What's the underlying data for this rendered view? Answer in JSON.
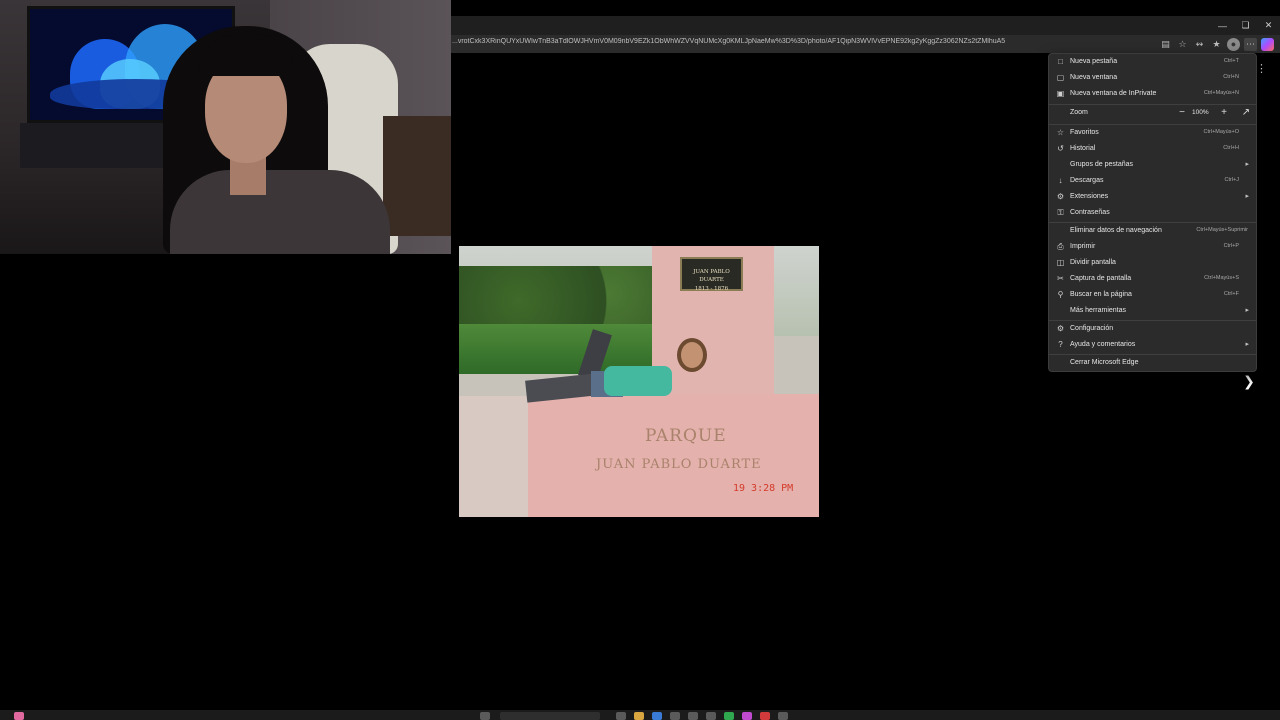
{
  "browser": {
    "url": "...vrotCxk3XRinQUYxUWIwTnB3aTdlOWJHVmV0M09nbV9EZk1ObWhWZVVqNUMcXg0KMLJpNaeMw%3D%3D/photo/AF1QipN3WVlVvEPNE92kg2yKggZz3062NZs2tZMlhuA5",
    "window_controls": [
      "minimize",
      "restore",
      "close"
    ],
    "toolbar_icons": [
      "reading-mode-icon",
      "favorite-star-icon",
      "extensions-icon",
      "favorites-bar-icon",
      "profile-icon",
      "more-menu-icon",
      "copilot-icon"
    ]
  },
  "photo": {
    "plaque_name": "JUAN PABLO DUARTE",
    "plaque_years": "1813 - 1876",
    "wall_line1": "PARQUE",
    "wall_line2": "JUAN PABLO DUARTE",
    "date_stamp": "19   3:28 PM"
  },
  "menu": {
    "items": [
      {
        "label": "Nueva pestaña",
        "shortcut": "Ctrl+T",
        "icon": "new-tab-icon"
      },
      {
        "label": "Nueva ventana",
        "shortcut": "Ctrl+N",
        "icon": "new-window-icon"
      },
      {
        "label": "Nueva ventana de InPrivate",
        "shortcut": "Ctrl+Mayús+N",
        "icon": "inprivate-icon"
      },
      {
        "label": "Favoritos",
        "shortcut": "Ctrl+Mayús+O",
        "icon": "favorites-icon"
      },
      {
        "label": "Historial",
        "shortcut": "Ctrl+H",
        "icon": "history-icon"
      },
      {
        "label": "Grupos de pestañas",
        "shortcut": "",
        "icon": "tab-groups-icon"
      },
      {
        "label": "Descargas",
        "shortcut": "Ctrl+J",
        "icon": "downloads-icon"
      },
      {
        "label": "Extensiones",
        "shortcut": "",
        "icon": "extensions-icon"
      },
      {
        "label": "Contraseñas",
        "shortcut": "",
        "icon": "passwords-icon"
      },
      {
        "label": "Eliminar datos de navegación",
        "shortcut": "Ctrl+Mayús+Suprimir",
        "icon": "clear-data-icon"
      },
      {
        "label": "Imprimir",
        "shortcut": "Ctrl+P",
        "icon": "print-icon"
      },
      {
        "label": "Dividir pantalla",
        "shortcut": "",
        "icon": "split-screen-icon"
      },
      {
        "label": "Captura de pantalla",
        "shortcut": "Ctrl+Mayús+S",
        "icon": "screenshot-icon"
      },
      {
        "label": "Buscar en la página",
        "shortcut": "Ctrl+F",
        "icon": "find-icon"
      },
      {
        "label": "Más herramientas",
        "shortcut": "",
        "icon": ""
      },
      {
        "label": "Configuración",
        "shortcut": "",
        "icon": "settings-icon"
      },
      {
        "label": "Ayuda y comentarios",
        "shortcut": "",
        "icon": "help-icon"
      },
      {
        "label": "Cerrar Microsoft Edge",
        "shortcut": "",
        "icon": ""
      }
    ],
    "zoom_label": "Zoom",
    "zoom_value": "100%"
  }
}
